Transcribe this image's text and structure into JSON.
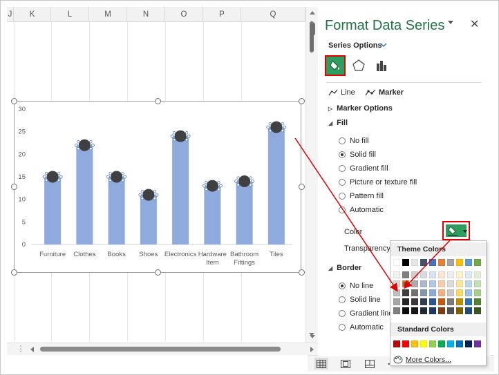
{
  "sheet": {
    "columns": [
      "J",
      "K",
      "L",
      "M",
      "N",
      "O",
      "P",
      "Q"
    ]
  },
  "chart_data": {
    "type": "bar",
    "categories": [
      "Furniture",
      "Clothes",
      "Books",
      "Shoes",
      "Electronics",
      "Hardware Item",
      "Bathroom Fittings",
      "Tiles"
    ],
    "category_lines": [
      [
        "Furniture"
      ],
      [
        "Clothes"
      ],
      [
        "Books"
      ],
      [
        "Shoes"
      ],
      [
        "Electronics"
      ],
      [
        "Hardware",
        "Item"
      ],
      [
        "Bathroom",
        "Fittings"
      ],
      [
        "Tiles"
      ]
    ],
    "series": [
      {
        "values": [
          15,
          22,
          15,
          11,
          24,
          13,
          14,
          26
        ]
      }
    ],
    "marker_values": [
      15,
      22,
      15,
      11,
      24,
      13,
      14,
      26
    ],
    "ylim": [
      0,
      30
    ],
    "yticks": [
      0,
      5,
      10,
      15,
      20,
      25,
      30
    ],
    "bar_color": "#8faadc",
    "marker_color": "#404040",
    "grid": false
  },
  "pane": {
    "title": "Format Data Series",
    "close_glyph": "✕",
    "series_options_label": "Series Options",
    "subtabs": {
      "line": "Line",
      "marker": "Marker"
    },
    "marker_options_label": "Marker Options",
    "fill": {
      "header": "Fill",
      "options": [
        "No fill",
        "Solid fill",
        "Gradient fill",
        "Picture or texture fill",
        "Pattern fill",
        "Automatic"
      ],
      "selected_index": 1
    },
    "color_label": "Color",
    "transparency_label": "Transparency",
    "border": {
      "header": "Border",
      "options": [
        "No line",
        "Solid line",
        "Gradient line",
        "Automatic"
      ],
      "selected_index": 0
    },
    "accent_color": "#217346",
    "highlight_color": "#e00000"
  },
  "color_popup": {
    "theme_header": "Theme Colors",
    "standard_header": "Standard Colors",
    "more_colors": "More Colors...",
    "theme_columns": [
      [
        "#ffffff",
        "#f2f2f2",
        "#d9d9d9",
        "#bfbfbf",
        "#a6a6a6",
        "#808080"
      ],
      [
        "#000000",
        "#7f7f7f",
        "#595959",
        "#3f3f3f",
        "#262626",
        "#0d0d0d"
      ],
      [
        "#e7e6e6",
        "#d0cece",
        "#aeabab",
        "#757171",
        "#3a3838",
        "#171616"
      ],
      [
        "#44546a",
        "#d6dce4",
        "#adb9ca",
        "#8497b0",
        "#333f4f",
        "#222a35"
      ],
      [
        "#4472c4",
        "#d9e2f3",
        "#b4c6e7",
        "#8eaadb",
        "#2f5496",
        "#1f3864"
      ],
      [
        "#ed7d31",
        "#fbe5d5",
        "#f7cbac",
        "#f4b183",
        "#c55a11",
        "#833c0b"
      ],
      [
        "#a5a5a5",
        "#ededed",
        "#dbdbdb",
        "#c9c9c9",
        "#7b7b7b",
        "#525252"
      ],
      [
        "#ffc000",
        "#fff2cc",
        "#fee599",
        "#ffd965",
        "#bf9000",
        "#7f6000"
      ],
      [
        "#5b9bd5",
        "#deebf6",
        "#bdd7ee",
        "#9cc3e5",
        "#2e75b5",
        "#1e4e79"
      ],
      [
        "#70ad47",
        "#e2efd9",
        "#c5e0b3",
        "#a8d08d",
        "#538135",
        "#375623"
      ]
    ],
    "standard_colors": [
      "#c00000",
      "#ff0000",
      "#ffc000",
      "#ffff00",
      "#92d050",
      "#00b050",
      "#00b0f0",
      "#0070c0",
      "#002060",
      "#7030a0"
    ]
  }
}
